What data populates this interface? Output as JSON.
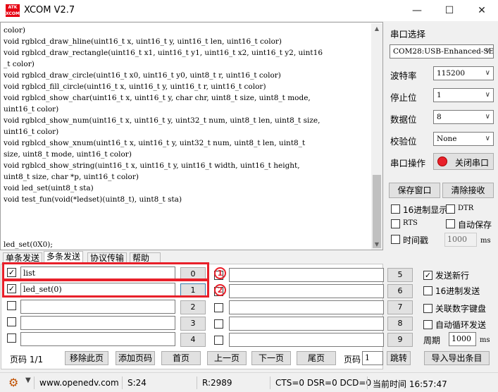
{
  "window": {
    "title": "XCOM V2.7",
    "logo_text": "ATK XCOM"
  },
  "receive": {
    "text": "color)\nvoid rgblcd_draw_hline(uint16_t x, uint16_t y, uint16_t len, uint16_t color)\nvoid rgblcd_draw_rectangle(uint16_t x1, uint16_t y1, uint16_t x2, uint16_t y2, uint16\n_t color)\nvoid rgblcd_draw_circle(uint16_t x0, uint16_t y0, uint8_t r, uint16_t color)\nvoid rgblcd_fill_circle(uint16_t x, uint16_t y, uint16_t r, uint16_t color)\nvoid rgblcd_show_char(uint16_t x, uint16_t y, char chr, uint8_t size, uint8_t mode,\nuint16_t color)\nvoid rgblcd_show_num(uint16_t x, uint16_t y, uint32_t num, uint8_t len, uint8_t size,\nuint16_t color)\nvoid rgblcd_show_xnum(uint16_t x, uint16_t y, uint32_t num, uint8_t len, uint8_t\nsize, uint8_t mode, uint16_t color)\nvoid rgblcd_show_string(uint16_t x, uint16_t y, uint16_t width, uint16_t height,\nuint8_t size, char *p, uint16_t color)\nvoid led_set(uint8_t sta)\nvoid test_fun(void(*ledset)(uint8_t), uint8_t sta)\n\n\n\nled_set(0X0);"
  },
  "settings": {
    "port_label": "串口选择",
    "port_value": "COM28:USB-Enhanced-SE",
    "baud_label": "波特率",
    "baud_value": "115200",
    "stop_label": "停止位",
    "stop_value": "1",
    "data_label": "数据位",
    "data_value": "8",
    "parity_label": "校验位",
    "parity_value": "None",
    "op_label": "串口操作",
    "op_button": "关闭串口",
    "save_button": "保存窗口",
    "clear_button": "清除接收",
    "hex_display": "16进制显示",
    "dtr": "DTR",
    "rts": "RTS",
    "auto_save": "自动保存",
    "timestamp": "时间戳",
    "timestamp_value": "1000",
    "ms": "ms"
  },
  "tabs": [
    "单条发送",
    "多条发送",
    "协议传输",
    "帮助"
  ],
  "multi": {
    "rows_left": [
      {
        "checked": true,
        "text": "list",
        "num": "0"
      },
      {
        "checked": true,
        "text": "led_set(0)",
        "num": "1"
      },
      {
        "checked": false,
        "text": "",
        "num": "2"
      },
      {
        "checked": false,
        "text": "",
        "num": "3"
      },
      {
        "checked": false,
        "text": "",
        "num": "4"
      }
    ],
    "rows_right": [
      {
        "checked": false,
        "text": "",
        "num": "5"
      },
      {
        "checked": false,
        "text": "",
        "num": "6"
      },
      {
        "checked": false,
        "text": "",
        "num": "7"
      },
      {
        "checked": false,
        "text": "",
        "num": "8"
      },
      {
        "checked": false,
        "text": "",
        "num": "9"
      }
    ],
    "annotations": [
      "1",
      "2"
    ],
    "send_newline": "发送新行",
    "hex_send": "16进制发送",
    "link_keyboard": "关联数字键盘",
    "auto_loop": "自动循环发送",
    "period_label": "周期",
    "period_value": "1000",
    "period_unit": "ms",
    "page_label": "页码 1/1",
    "remove_page": "移除此页",
    "add_page": "添加页码",
    "first_page": "首页",
    "prev_page": "上一页",
    "next_page": "下一页",
    "last_page": "尾页",
    "page_input_label": "页码",
    "page_input_value": "1",
    "jump": "跳转",
    "import_export": "导入导出条目"
  },
  "status": {
    "website": "www.openedv.com",
    "sent": "S:24",
    "received": "R:2989",
    "signals": "CTS=0 DSR=0 DCD=0",
    "time": "当前时间 16:57:47"
  }
}
